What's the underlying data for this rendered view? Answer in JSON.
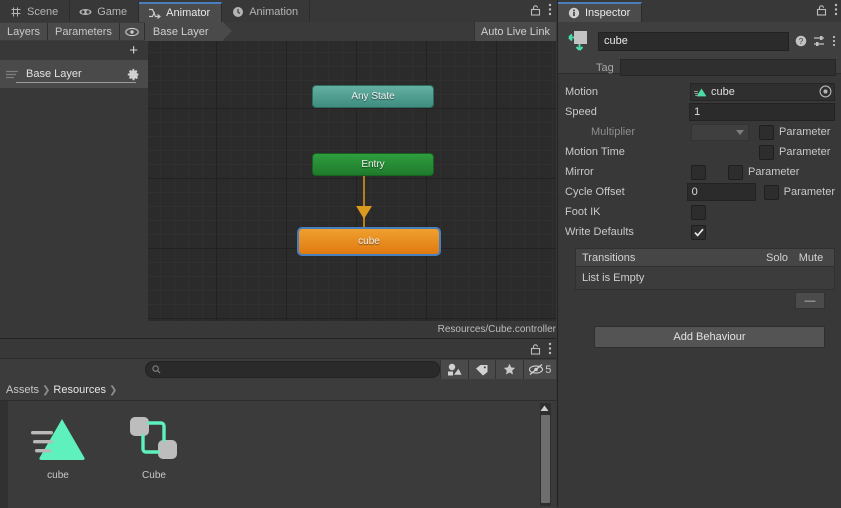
{
  "animator": {
    "tabs": [
      {
        "label": "Scene",
        "icon": "grid-icon",
        "active": false
      },
      {
        "label": "Game",
        "icon": "gamepad-icon",
        "active": false
      },
      {
        "label": "Animator",
        "icon": "animator-icon",
        "active": true
      },
      {
        "label": "Animation",
        "icon": "clock-icon",
        "active": false
      }
    ],
    "toolbar": {
      "layers_label": "Layers",
      "parameters_label": "Parameters",
      "eye_icon": "eye-icon",
      "breadcrumb": "Base Layer",
      "auto_live_link": "Auto Live Link"
    },
    "layers_panel": {
      "add_label": "+",
      "layer_name": "Base Layer",
      "gear_icon": "gear-icon"
    },
    "graph": {
      "nodes": [
        {
          "id": "any-state",
          "label": "Any State",
          "type": "any"
        },
        {
          "id": "entry",
          "label": "Entry",
          "type": "entry"
        },
        {
          "id": "cube",
          "label": "cube",
          "type": "state",
          "selected": true
        }
      ],
      "controller_path": "Resources/Cube.controller"
    }
  },
  "project": {
    "search_placeholder": "",
    "filters": [
      "type-filter-icon",
      "label-filter-icon",
      "favorites-star-icon",
      "hidden-eye-icon"
    ],
    "hidden_count": "5",
    "breadcrumbs": [
      "Assets",
      "Resources"
    ],
    "assets": [
      {
        "name": "cube",
        "icon": "animation-clip-icon"
      },
      {
        "name": "Cube",
        "icon": "animator-controller-icon"
      }
    ]
  },
  "inspector": {
    "tab_label": "Inspector",
    "tab_icon": "info-icon",
    "state_icon": "animator-state-icon",
    "name_value": "cube",
    "tag_label": "Tag",
    "tag_value": "",
    "head_icons": [
      "help-icon",
      "preset-icon",
      "kebab-icon"
    ],
    "properties": {
      "motion_label": "Motion",
      "motion_value": "cube",
      "speed_label": "Speed",
      "speed_value": "1",
      "multiplier_label": "Multiplier",
      "multiplier_value": "",
      "motion_time_label": "Motion Time",
      "mirror_label": "Mirror",
      "cycle_offset_label": "Cycle Offset",
      "cycle_offset_value": "0",
      "foot_ik_label": "Foot IK",
      "write_defaults_label": "Write Defaults",
      "parameter_label": "Parameter"
    },
    "transitions": {
      "header": "Transitions",
      "solo": "Solo",
      "mute": "Mute",
      "empty_text": "List is Empty",
      "remove_label": "—"
    },
    "add_behaviour_label": "Add Behaviour"
  },
  "window_icons": {
    "lock_icon": "lock-icon",
    "kebab_icon": "kebab-menu-icon"
  },
  "colors": {
    "accent_blue": "#4a7fbd",
    "state_orange": "#e07a10",
    "entry_green": "#1f7a2c",
    "any_state_teal": "#3f8d80",
    "clip_teal": "#5ef0bd"
  }
}
